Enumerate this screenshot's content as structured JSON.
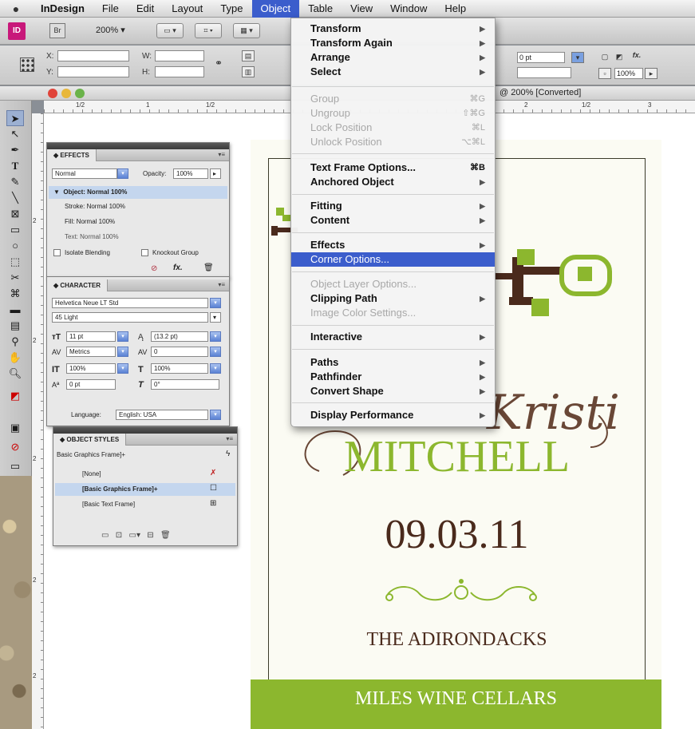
{
  "menubar": {
    "items": [
      "InDesign",
      "File",
      "Edit",
      "Layout",
      "Type",
      "Object",
      "Table",
      "View",
      "Window",
      "Help"
    ],
    "active": "Object"
  },
  "appbar": {
    "app_logo": "ID",
    "bridge_logo": "Br",
    "zoom": "200%"
  },
  "controlbar": {
    "x_label": "X:",
    "y_label": "Y:",
    "w_label": "W:",
    "h_label": "H:",
    "stroke_weight": "0 pt",
    "scale": "100%"
  },
  "document": {
    "title": "@ 200% [Converted]",
    "ruler_labels": [
      "1/2",
      "1",
      "1/2",
      "2",
      "1/2",
      "3"
    ]
  },
  "effects_panel": {
    "title": "EFFECTS",
    "blend_mode": "Normal",
    "opacity_label": "Opacity:",
    "opacity_value": "100%",
    "rows": [
      "Object: Normal 100%",
      "Stroke:   Normal 100%",
      "Fill:   Normal 100%",
      "Text:   Normal 100%"
    ],
    "isolate_label": "Isolate Blending",
    "knockout_label": "Knockout Group"
  },
  "character_panel": {
    "title": "CHARACTER",
    "font_family": "Helvetica Neue LT Std",
    "font_style": "45 Light",
    "size": "11 pt",
    "leading": "(13.2 pt)",
    "kerning": "Metrics",
    "tracking": "0",
    "vscale": "100%",
    "hscale": "100%",
    "baseline": "0 pt",
    "skew": "0°",
    "language_label": "Language:",
    "language": "English: USA"
  },
  "object_styles_panel": {
    "title": "OBJECT STYLES",
    "current": "Basic Graphics Frame]+",
    "items": [
      "[None]",
      "[Basic Graphics Frame]+",
      "[Basic Text Frame]"
    ]
  },
  "object_menu": {
    "items": [
      {
        "label": "Transform",
        "state": "bold",
        "submenu": true
      },
      {
        "label": "Transform Again",
        "state": "bold",
        "submenu": true
      },
      {
        "label": "Arrange",
        "state": "bold",
        "submenu": true
      },
      {
        "label": "Select",
        "state": "bold",
        "submenu": true
      },
      {
        "label": "Group",
        "state": "disabled",
        "shortcut": "⌘G"
      },
      {
        "label": "Ungroup",
        "state": "disabled",
        "shortcut": "⇧⌘G"
      },
      {
        "label": "Lock Position",
        "state": "disabled",
        "shortcut": "⌘L"
      },
      {
        "label": "Unlock Position",
        "state": "disabled",
        "shortcut": "⌥⌘L"
      },
      {
        "label": "Text Frame Options...",
        "state": "bold",
        "shortcut": "⌘B"
      },
      {
        "label": "Anchored Object",
        "state": "bold",
        "submenu": true
      },
      {
        "label": "Fitting",
        "state": "bold",
        "submenu": true
      },
      {
        "label": "Content",
        "state": "bold",
        "submenu": true
      },
      {
        "label": "Effects",
        "state": "bold",
        "submenu": true
      },
      {
        "label": "Corner Options...",
        "state": "hover"
      },
      {
        "label": "Object Layer Options...",
        "state": "disabled"
      },
      {
        "label": "Clipping Path",
        "state": "bold",
        "submenu": true
      },
      {
        "label": "Image Color Settings...",
        "state": "disabled"
      },
      {
        "label": "Interactive",
        "state": "bold",
        "submenu": true
      },
      {
        "label": "Paths",
        "state": "bold",
        "submenu": true
      },
      {
        "label": "Pathfinder",
        "state": "bold",
        "submenu": true
      },
      {
        "label": "Convert Shape",
        "state": "bold",
        "submenu": true
      },
      {
        "label": "Display Performance",
        "state": "bold",
        "submenu": true
      }
    ]
  },
  "card": {
    "script_names": "Kristi",
    "surname": "MITCHELL",
    "date": "09.03.11",
    "location": "THE ADIRONDACKS",
    "venue": "MILES WINE CELLARS",
    "colors": {
      "green": "#8cb72e",
      "brown": "#4a2a1c",
      "cream": "#fbfbf3"
    }
  }
}
